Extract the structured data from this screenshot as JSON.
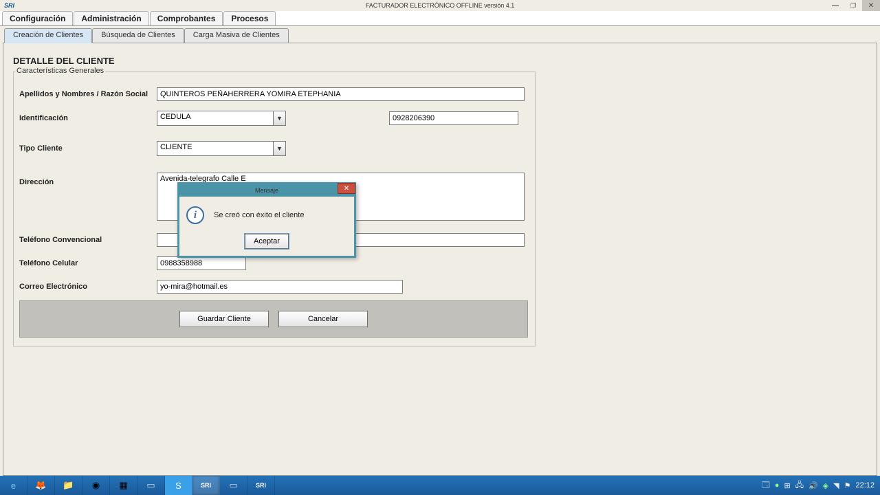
{
  "window": {
    "logo": "SRI",
    "title": "FACTURADOR ELECTRÓNICO OFFLINE versión 4.1"
  },
  "menus": {
    "m1": "Configuración",
    "m2": "Administración",
    "m3": "Comprobantes",
    "m4": "Procesos"
  },
  "tabs": {
    "t1": "Creación de Clientes",
    "t2": "Búsqueda de Clientes",
    "t3": "Carga Masiva de Clientes"
  },
  "section_title": "DETALLE DEL CLIENTE",
  "fieldset_legend": "Características Generales",
  "labels": {
    "razon": "Apellidos y Nombres / Razón Social",
    "ident": "Identificación",
    "tipo": "Tipo Cliente",
    "direccion": "Dirección",
    "tel_conv": "Teléfono Convencional",
    "tel_cel": "Teléfono Celular",
    "correo": "Correo Electrónico"
  },
  "values": {
    "razon": "QUINTEROS PEÑAHERRERA YOMIRA ETEPHANIA",
    "ident_type": "CEDULA",
    "ident_num": "0928206390",
    "tipo": "CLIENTE",
    "direccion": "Avenida-telegrafo Calle E",
    "tel_conv": "",
    "tel_cel": "0988358988",
    "correo": "yo-mira@hotmail.es"
  },
  "buttons": {
    "guardar": "Guardar Cliente",
    "cancelar": "Cancelar"
  },
  "modal": {
    "title": "Mensaje",
    "message": "Se creó con éxito el cliente",
    "ok": "Aceptar"
  },
  "taskbar": {
    "clock": "22:12"
  }
}
